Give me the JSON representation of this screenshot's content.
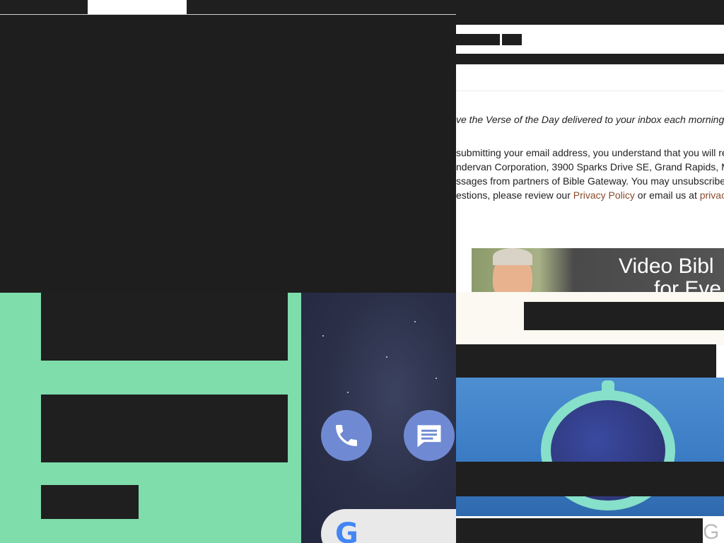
{
  "verse_signup": {
    "intro": "ve the Verse of the Day delivered to your inbox each morning.",
    "legal_lines": [
      "submitting your email address, you understand that you will re",
      "ndervan Corporation, 3900 Sparks Drive SE, Grand Rapids, M",
      "ssages from partners of Bible Gateway. You may unsubscribe",
      "estions, please review our "
    ],
    "privacy_policy_link": "Privacy Policy",
    "or_email_text": " or email us at ",
    "privacy_email_link": "privacy"
  },
  "video_banner": {
    "line1": "Video Bibl",
    "line2": "for Eve"
  },
  "phone": {
    "phone_icon": "phone-icon",
    "messages_icon": "messages-icon",
    "search_logo": "G"
  },
  "colors": {
    "mint": "#7fdcab",
    "link": "#8a4b2c",
    "dark": "#1f1f1f"
  }
}
